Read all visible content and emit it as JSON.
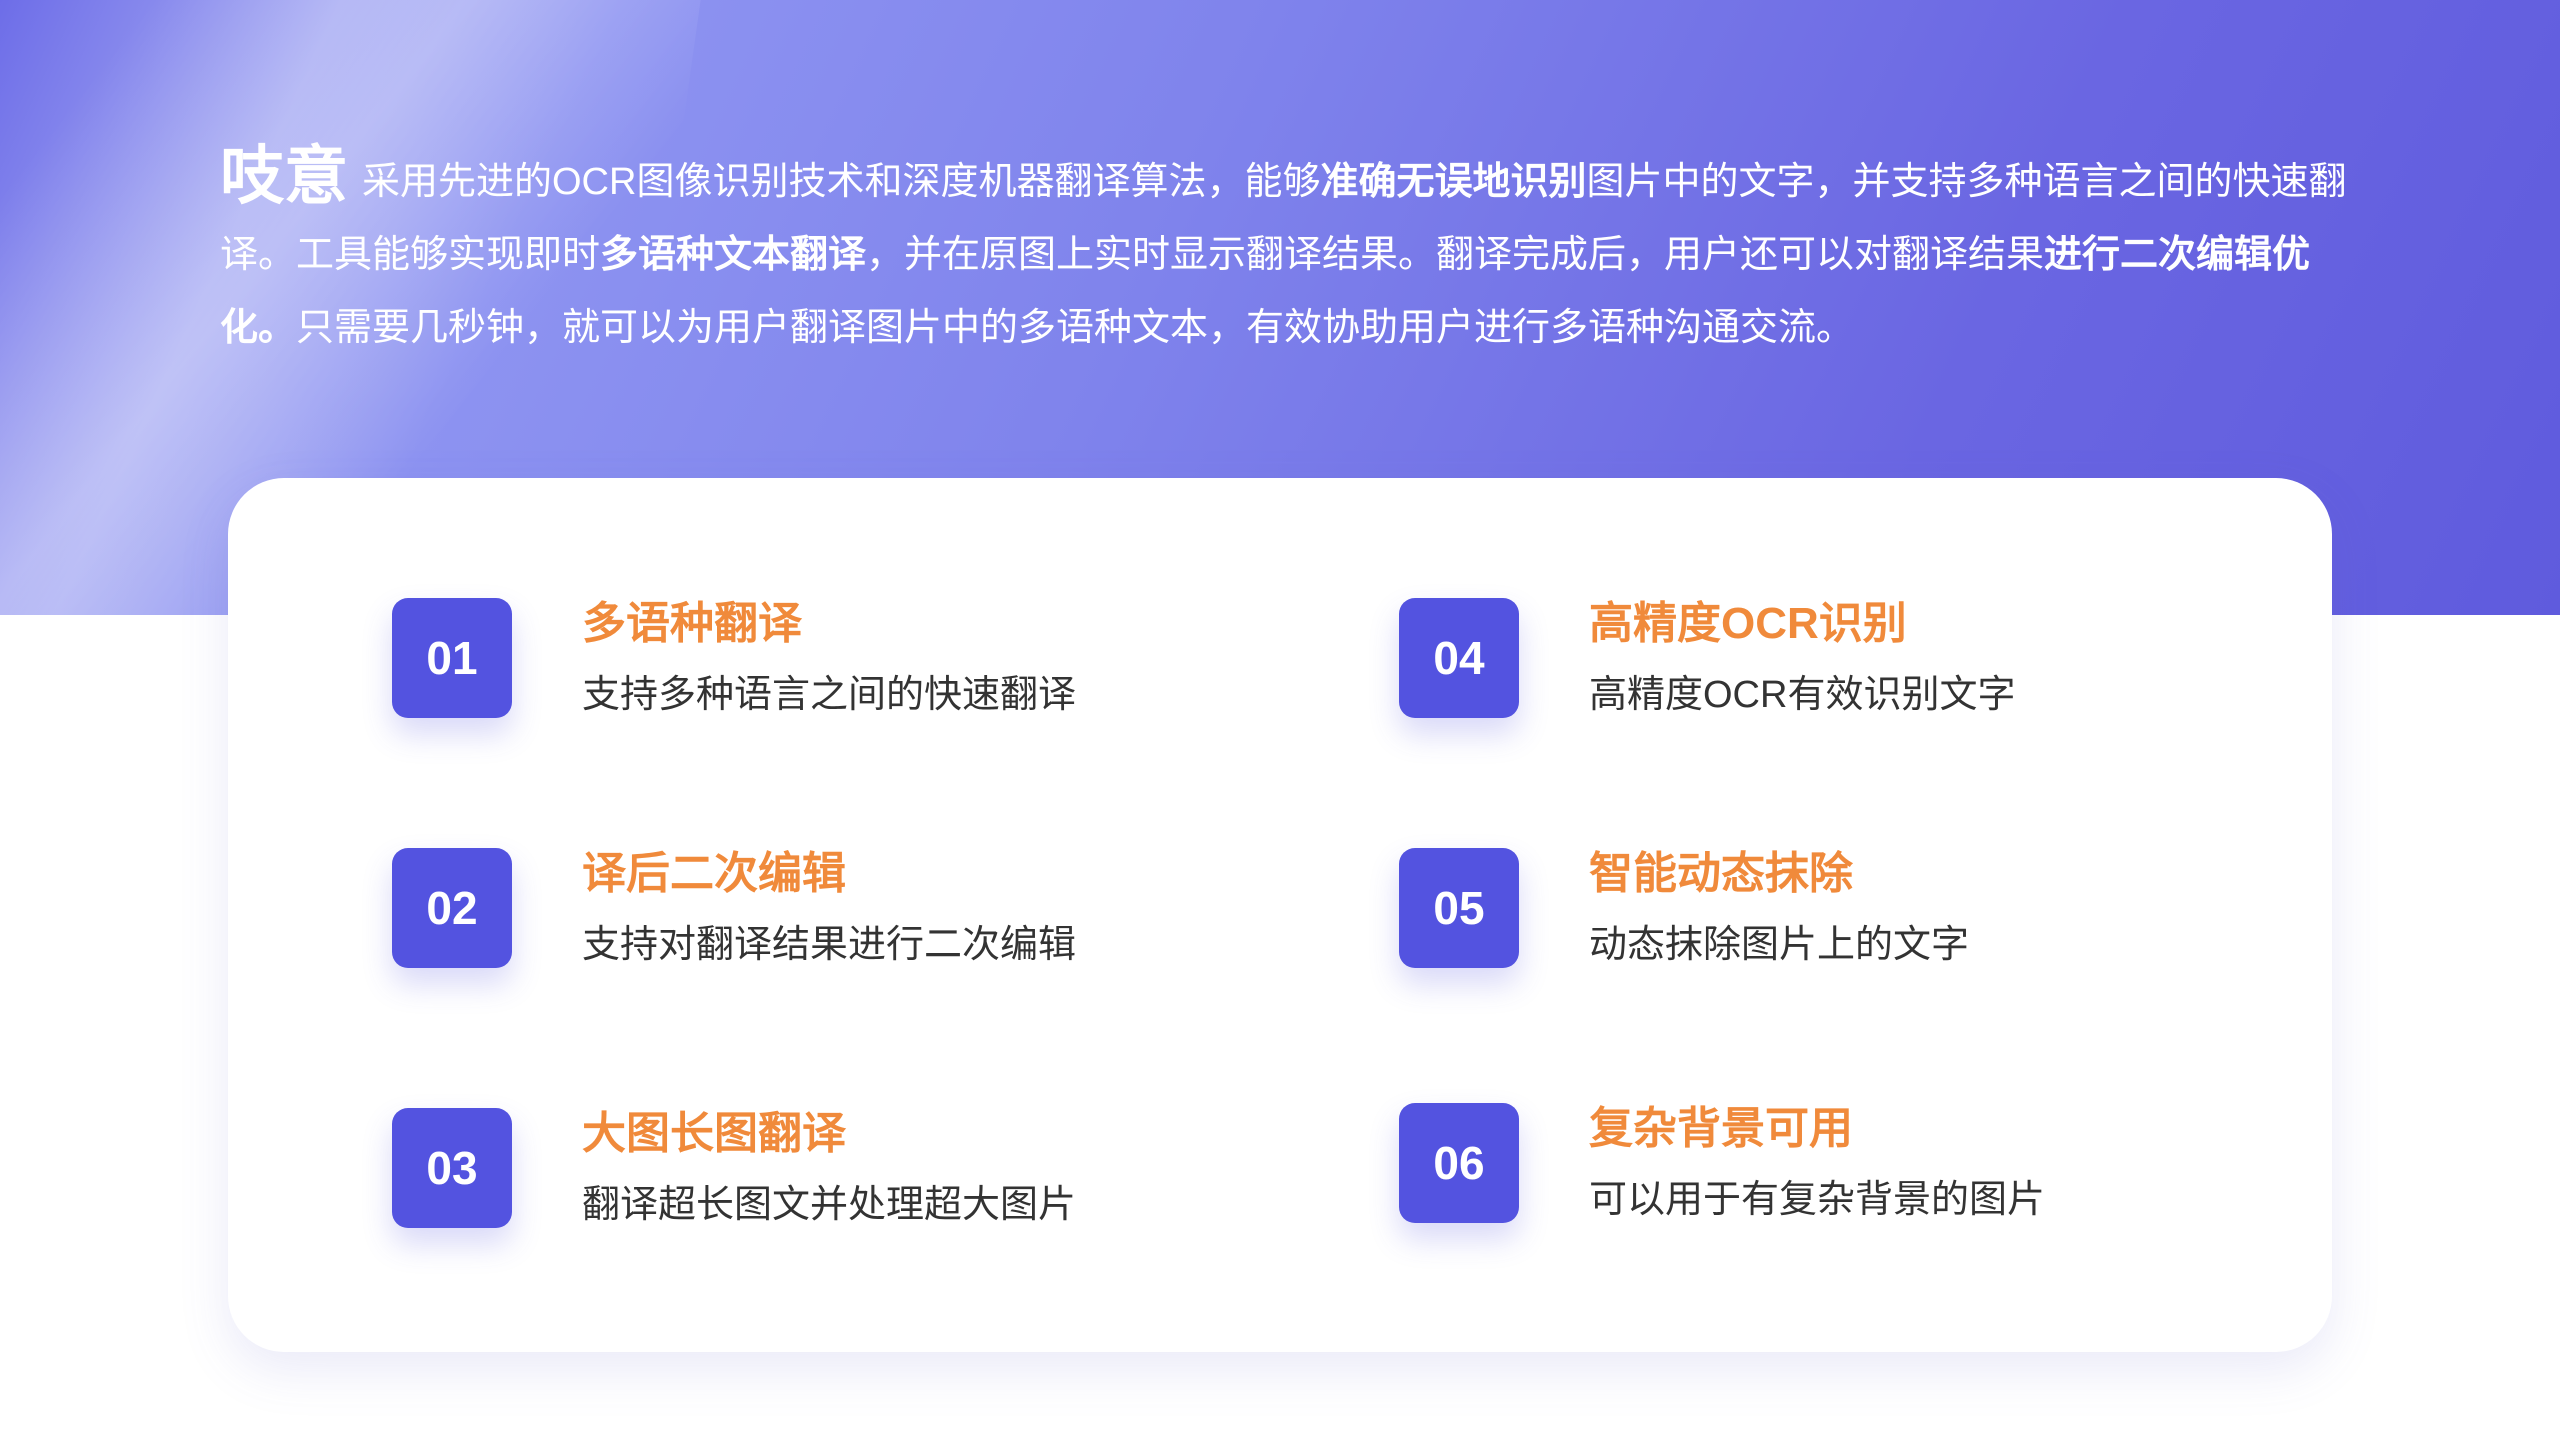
{
  "intro": {
    "brand": "吱意",
    "segments": [
      {
        "text": "采用先进的OCR图像识别技术和深度机器翻译算法，能够",
        "bold": false
      },
      {
        "text": "准确无误地识别",
        "bold": true
      },
      {
        "text": "图片中的文字，并支持多种语言之间的快速翻译。工具能够实现即时",
        "bold": false
      },
      {
        "text": "多语种文本翻译",
        "bold": true
      },
      {
        "text": "，并在原图上实时显示翻译结果。翻译完成后，用户还可以对翻译结果",
        "bold": false
      },
      {
        "text": "进行二次编辑优化。",
        "bold": true
      },
      {
        "text": "只需要几秒钟，就可以为用户翻译图片中的多语种文本，有效协助用户进行多语种沟通交流。",
        "bold": false
      }
    ]
  },
  "features": [
    {
      "num": "01",
      "title": "多语种翻译",
      "desc": "支持多种语言之间的快速翻译"
    },
    {
      "num": "02",
      "title": "译后二次编辑",
      "desc": "支持对翻译结果进行二次编辑"
    },
    {
      "num": "03",
      "title": "大图长图翻译",
      "desc": "翻译超长图文并处理超大图片"
    },
    {
      "num": "04",
      "title": "高精度OCR识别",
      "desc": "高精度OCR有效识别文字"
    },
    {
      "num": "05",
      "title": "智能动态抹除",
      "desc": "动态抹除图片上的文字"
    },
    {
      "num": "06",
      "title": "复杂背景可用",
      "desc": "可以用于有复杂背景的图片"
    }
  ],
  "colors": {
    "accent": "#5353e0",
    "title_orange": "#f08a3b"
  }
}
